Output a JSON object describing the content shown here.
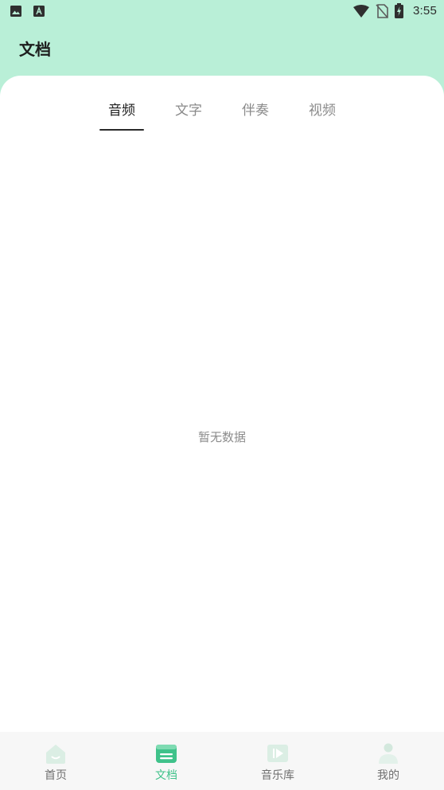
{
  "status_bar": {
    "time": "3:55",
    "left_icons": [
      "image-icon",
      "text-a-icon"
    ],
    "right_icons": [
      "wifi-icon",
      "no-sim-icon",
      "battery-charging-icon"
    ]
  },
  "header": {
    "title": "文档"
  },
  "tabs": [
    {
      "label": "音频",
      "active": true
    },
    {
      "label": "文字",
      "active": false
    },
    {
      "label": "伴奏",
      "active": false
    },
    {
      "label": "视频",
      "active": false
    }
  ],
  "empty_state": {
    "message": "暂无数据"
  },
  "bottom_nav": {
    "items": [
      {
        "label": "首页",
        "icon": "home-icon",
        "active": false
      },
      {
        "label": "文档",
        "icon": "document-icon",
        "active": true
      },
      {
        "label": "音乐库",
        "icon": "music-library-icon",
        "active": false
      },
      {
        "label": "我的",
        "icon": "profile-icon",
        "active": false
      }
    ]
  },
  "colors": {
    "header_bg": "#b9efd7",
    "accent": "#3fc28a",
    "inactive_icon": "#dbeee4"
  }
}
